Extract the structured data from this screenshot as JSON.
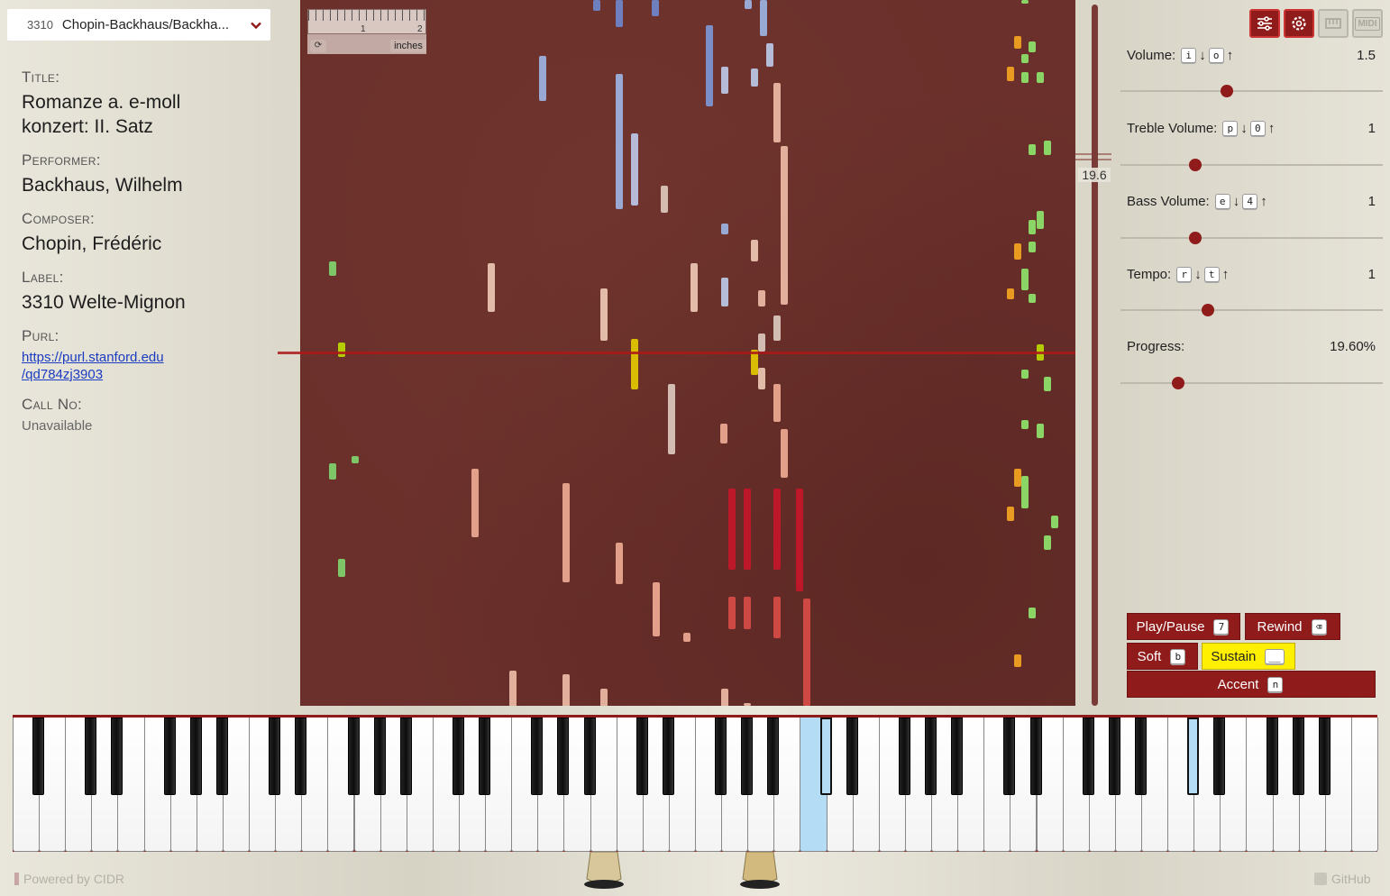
{
  "roll_select": {
    "number": "3310",
    "title": "Chopin-Backhaus/Backha..."
  },
  "metadata": {
    "title_label": "Title:",
    "title": "Romanze a. e-moll konzert: II. Satz",
    "performer_label": "Performer:",
    "performer": "Backhaus, Wilhelm",
    "composer_label": "Composer:",
    "composer": "Chopin, Frédéric",
    "label_label": "Label:",
    "label": "3310 Welte-Mignon",
    "purl_label": "Purl:",
    "purl_line1": "https://purl.stanford.edu",
    "purl_line2": "/qd784zj3903",
    "callno_label": "Call No:",
    "callno": "Unavailable"
  },
  "ruler": {
    "tick1": "1",
    "tick2": "2",
    "units": "inches"
  },
  "progress_readout": "19.6",
  "toolbar": {
    "midi_label": "MIDI"
  },
  "controls": {
    "volume": {
      "label": "Volume:",
      "key_down": "i",
      "key_up": "o",
      "value": "1.5",
      "level": 0.38
    },
    "treble": {
      "label": "Treble Volume:",
      "key_down": "p",
      "key_up": "0",
      "value": "1",
      "level": 0.26
    },
    "bass": {
      "label": "Bass Volume:",
      "key_down": "e",
      "key_up": "4",
      "value": "1",
      "level": 0.26
    },
    "tempo": {
      "label": "Tempo:",
      "key_down": "r",
      "key_up": "t",
      "value": "1",
      "level": 0.31
    },
    "progress": {
      "label": "Progress:",
      "value": "19.60%",
      "level": 0.196
    }
  },
  "arrows": {
    "down": "↓",
    "up": "↑"
  },
  "buttons": {
    "play": {
      "label": "Play/Pause",
      "key": "7"
    },
    "rewind": {
      "label": "Rewind",
      "key": "⌫"
    },
    "soft": {
      "label": "Soft",
      "key": "b"
    },
    "sustain": {
      "label": "Sustain",
      "key": "__"
    },
    "accent": {
      "label": "Accent",
      "key": "n"
    }
  },
  "footer": {
    "powered": "Powered by CIDR",
    "github": "GitHub"
  },
  "colors": {
    "accent": "#8f1b1b",
    "roll": "#6b302b",
    "sustain": "#ffef00",
    "active_key": "#b4dcf5"
  }
}
